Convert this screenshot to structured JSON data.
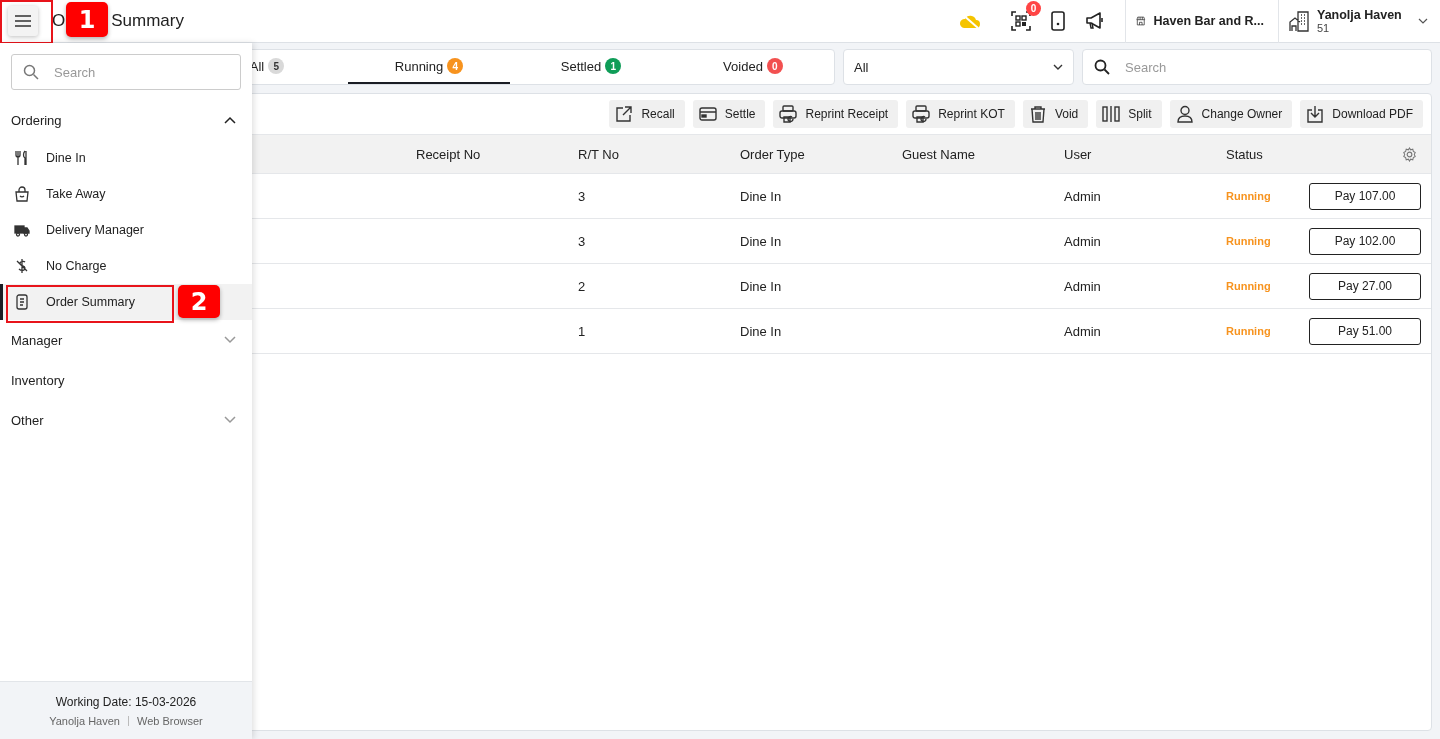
{
  "header": {
    "menu_button": {
      "callout": "1"
    },
    "title_parts": [
      "O",
      "Summary"
    ],
    "qr_badge": "0",
    "outlet": "Haven Bar and R...",
    "account": {
      "name": "Yanolja Haven",
      "sub": "51"
    }
  },
  "tabs": [
    {
      "label": "All",
      "count": "5",
      "color": "#d9d9d9",
      "selected": false
    },
    {
      "label": "Running",
      "count": "4",
      "color": "#f7931e",
      "selected": true
    },
    {
      "label": "Settled",
      "count": "1",
      "color": "#0f9d58",
      "selected": false
    },
    {
      "label": "Voided",
      "count": "0",
      "color": "#f25050",
      "selected": false
    }
  ],
  "filter": {
    "value": "All"
  },
  "search": {
    "placeholder": "Search"
  },
  "actions": [
    "Recall",
    "Settle",
    "Reprint Receipt",
    "Reprint KOT",
    "Void",
    "Split",
    "Change Owner",
    "Download PDF"
  ],
  "table": {
    "columns": [
      "Receipt No",
      "R/T No",
      "Order Type",
      "Guest Name",
      "User",
      "Status"
    ],
    "rows": [
      {
        "rt": "3",
        "type": "Dine In",
        "user": "Admin",
        "status": "Running",
        "pay": "Pay 107.00"
      },
      {
        "rt": "3",
        "type": "Dine In",
        "user": "Admin",
        "status": "Running",
        "pay": "Pay 102.00"
      },
      {
        "rt": "2",
        "type": "Dine In",
        "user": "Admin",
        "status": "Running",
        "pay": "Pay 27.00"
      },
      {
        "rt": "1",
        "type": "Dine In",
        "user": "Admin",
        "status": "Running",
        "pay": "Pay 51.00"
      }
    ]
  },
  "sidebar": {
    "search": {
      "placeholder": "Search"
    },
    "groups": [
      {
        "label": "Ordering",
        "kind": "group",
        "expanded": true,
        "children": [
          {
            "label": "Dine In",
            "selected": false
          },
          {
            "label": "Take Away",
            "selected": false
          },
          {
            "label": "Delivery Manager",
            "selected": false
          },
          {
            "label": "No Charge",
            "selected": false
          },
          {
            "label": "Order Summary",
            "selected": true,
            "callout": "2"
          }
        ]
      },
      {
        "label": "Manager",
        "kind": "group",
        "expanded": false
      },
      {
        "label": "Inventory",
        "kind": "link"
      },
      {
        "label": "Other",
        "kind": "group",
        "expanded": false
      }
    ],
    "footer": {
      "date_label": "Working Date:",
      "date": "15-03-2026",
      "account": "Yanolja Haven",
      "device": "Web Browser"
    }
  }
}
